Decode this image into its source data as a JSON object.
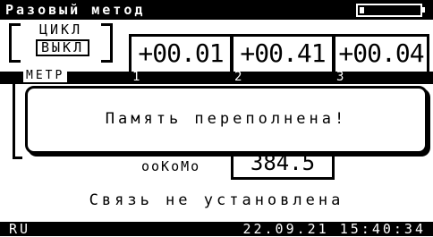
{
  "header": {
    "title": "Разовый метод"
  },
  "mode": {
    "cycle_label": "ЦИКЛ",
    "single_label": "ВЫКЛ"
  },
  "values": [
    {
      "channel": "1",
      "value": "+00.01"
    },
    {
      "channel": "2",
      "value": "+00.41"
    },
    {
      "channel": "3",
      "value": "+00.04"
    }
  ],
  "meters_label": "МЕТР",
  "lower": {
    "label": "ооКоМо",
    "value": "384.5"
  },
  "dialog": {
    "message": "Память переполнена!"
  },
  "status": {
    "message": "Связь не установлена"
  },
  "footer": {
    "language": "RU",
    "datetime": "22.09.21 15:40:34"
  }
}
